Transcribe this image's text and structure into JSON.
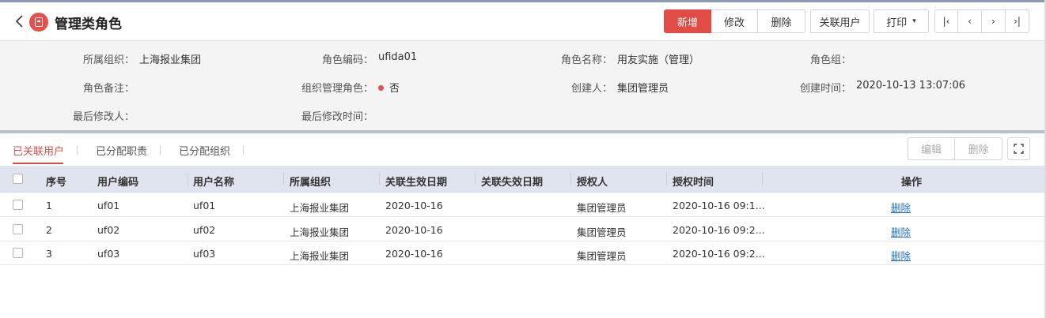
{
  "header": {
    "title": "管理类角色",
    "buttons": {
      "add": "新增",
      "edit": "修改",
      "delete": "删除",
      "link_users": "关联用户",
      "print": "打印"
    },
    "nav": {
      "first": "|‹",
      "prev": "‹",
      "next": "›",
      "last": "›|"
    }
  },
  "info": {
    "org": {
      "label": "所属组织：",
      "value": "上海报业集团"
    },
    "code": {
      "label": "角色编码：",
      "value": "ufida01"
    },
    "name": {
      "label": "角色名称：",
      "value": "用友实施（管理）"
    },
    "group": {
      "label": "角色组：",
      "value": ""
    },
    "remark": {
      "label": "角色备注：",
      "value": ""
    },
    "org_admin": {
      "label": "组织管理角色：",
      "value": "否"
    },
    "creator": {
      "label": "创建人：",
      "value": "集团管理员"
    },
    "created_time": {
      "label": "创建时间：",
      "value": "2020-10-13 13:07:06"
    },
    "modifier": {
      "label": "最后修改人：",
      "value": ""
    },
    "modified_time": {
      "label": "最后修改时间：",
      "value": ""
    }
  },
  "tabs": [
    "已关联用户",
    "已分配职责",
    "已分配组织"
  ],
  "tab_buttons": {
    "edit": "编辑",
    "delete": "删除"
  },
  "table": {
    "columns": [
      "序号",
      "用户编码",
      "用户名称",
      "所属组织",
      "关联生效日期",
      "关联失效日期",
      "授权人",
      "授权时间",
      "操作"
    ],
    "rows": [
      {
        "index": "1",
        "code": "uf01",
        "name": "uf01",
        "org": "上海报业集团",
        "start": "2020-10-16",
        "end": "",
        "grantor": "集团管理员",
        "time": "2020-10-16 09:1...",
        "action": "删除"
      },
      {
        "index": "2",
        "code": "uf02",
        "name": "uf02",
        "org": "上海报业集团",
        "start": "2020-10-16",
        "end": "",
        "grantor": "集团管理员",
        "time": "2020-10-16 09:2...",
        "action": "删除"
      },
      {
        "index": "3",
        "code": "uf03",
        "name": "uf03",
        "org": "上海报业集团",
        "start": "2020-10-16",
        "end": "",
        "grantor": "集团管理员",
        "time": "2020-10-16 09:2...",
        "action": "删除"
      }
    ]
  }
}
